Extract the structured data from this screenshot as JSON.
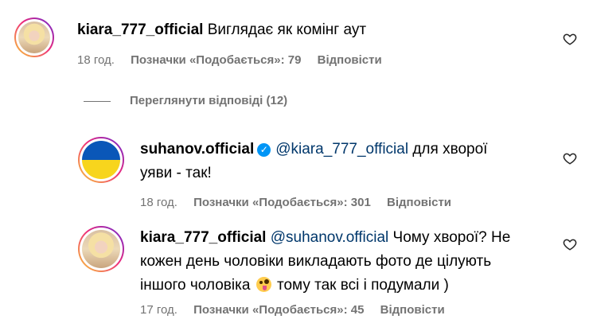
{
  "comments": [
    {
      "username": "kiara_777_official",
      "mention": "",
      "text_lines": [
        "Виглядає як комінг аут"
      ],
      "time": "18 год.",
      "likes": "Позначки «Подобається»: 79",
      "reply": "Відповісти",
      "avatar": "blonde-woman-photo"
    },
    {
      "username": "suhanov.official",
      "verified": true,
      "mention": "@kiara_777_official",
      "text_lines": [
        " для хворої",
        "уяви - так!"
      ],
      "time": "18 год.",
      "likes": "Позначки «Подобається»: 301",
      "reply": "Відповісти",
      "avatar": "ukrainian-flag"
    },
    {
      "username": "kiara_777_official",
      "mention": "@suhanov.official",
      "text_lines": [
        " Чому хворої? Не",
        "кожен день чоловіки викладають фото де цілують",
        "іншого чоловіка",
        " тому так всі і подумали )"
      ],
      "emoji": "zany-face-emoji",
      "time": "17 год.",
      "likes": "Позначки «Подобається»: 45",
      "reply": "Відповісти",
      "avatar": "blonde-woman-photo"
    }
  ],
  "replies_toggle": "Переглянути відповіді (12)",
  "icons": {
    "like": "heart-outline-icon",
    "verified": "verified-badge-icon"
  },
  "colors": {
    "mention": "#00376b",
    "meta": "#737373",
    "verified": "#0095f6"
  }
}
